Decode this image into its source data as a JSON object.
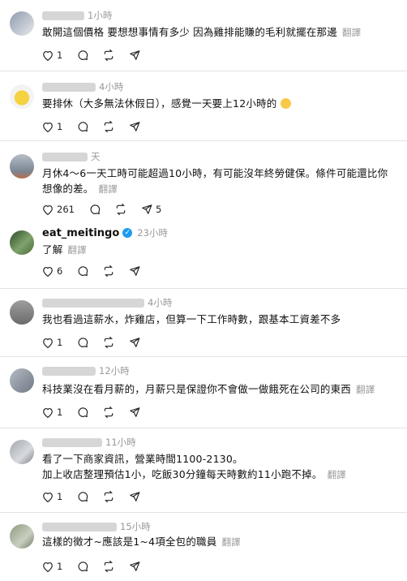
{
  "comments": [
    {
      "time": "1小時",
      "text": "敢開這個價格 要想想事情有多少 因為雞排能賺的毛利就擺在那邊",
      "translate": "翻譯",
      "likes": "1"
    },
    {
      "time": "4小時",
      "text": "要排休（大多無法休假日），感覺一天要上12小時的",
      "translate": "翻譯",
      "likes": "1"
    },
    {
      "time": "天",
      "text": "月休4～6一天工時可能超過10小時，有可能沒年終勞健保。條件可能還比你想像的差。",
      "translate": "翻譯",
      "likes": "261",
      "reposts": "5"
    },
    {
      "username": "eat_meitingo",
      "time": "23小時",
      "text": "了解",
      "translate": "翻譯",
      "likes": "6"
    },
    {
      "time": "4小時",
      "text": "我也看過這薪水，炸雞店，但算一下工作時數，跟基本工資差不多",
      "likes": "1"
    },
    {
      "time": "12小時",
      "text": "科技業沒在看月薪的，月薪只是保證你不會做一做餓死在公司的東西",
      "translate": "翻譯",
      "likes": "1"
    },
    {
      "time": "11小時",
      "text_line1": "看了一下商家資訊，營業時間1100-2130。",
      "text_line2": "加上收店整理預估1小，吃飯30分鐘每天時數約11小跑不掉。",
      "translate": "翻譯",
      "likes": "1"
    },
    {
      "time": "15小時",
      "text": "這樣的徵才~應該是1~4項全包的職員",
      "translate": "翻譯",
      "likes": "1"
    }
  ]
}
